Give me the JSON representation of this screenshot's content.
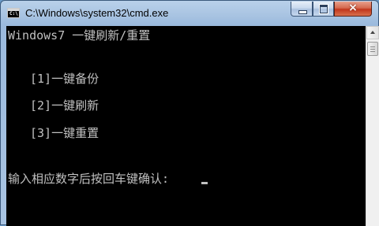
{
  "window": {
    "title": "C:\\Windows\\system32\\cmd.exe",
    "icon_text": "C:\\",
    "controls": {
      "minimize": "minimize",
      "maximize": "maximize",
      "close": "×"
    }
  },
  "console": {
    "header": "Windows7 一键刷新/重置",
    "menu": [
      {
        "text": "[1]一键备份"
      },
      {
        "text": "[2]一键刷新"
      },
      {
        "text": "[3]一键重置"
      }
    ],
    "prompt": "输入相应数字后按回车键确认:"
  },
  "colors": {
    "console_bg": "#000000",
    "console_text": "#c0c0c0",
    "title_bar": "#a9c4e2",
    "close_button": "#c2361c"
  }
}
